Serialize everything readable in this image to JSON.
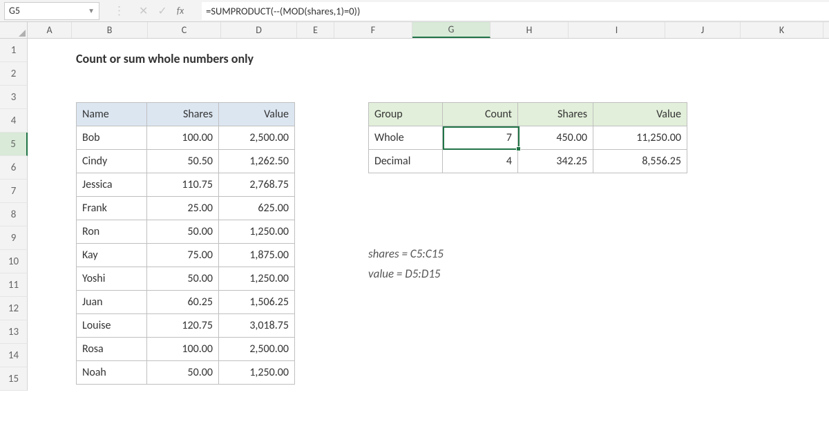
{
  "formula_bar": {
    "cell_ref": "G5",
    "fx_label": "fx",
    "formula": "=SUMPRODUCT(--(MOD(shares,1)=0))"
  },
  "columns": [
    "A",
    "B",
    "C",
    "D",
    "E",
    "F",
    "G",
    "H",
    "I",
    "J",
    "K"
  ],
  "active_column": "G",
  "rows": [
    "1",
    "2",
    "3",
    "4",
    "5",
    "6",
    "7",
    "8",
    "9",
    "10",
    "11",
    "12",
    "13",
    "14",
    "15"
  ],
  "active_row": "5",
  "title": "Count or sum whole numbers only",
  "table1": {
    "headers": {
      "name": "Name",
      "shares": "Shares",
      "value": "Value"
    },
    "rows": [
      {
        "name": "Bob",
        "shares": "100.00",
        "value": "2,500.00"
      },
      {
        "name": "Cindy",
        "shares": "50.50",
        "value": "1,262.50"
      },
      {
        "name": "Jessica",
        "shares": "110.75",
        "value": "2,768.75"
      },
      {
        "name": "Frank",
        "shares": "25.00",
        "value": "625.00"
      },
      {
        "name": "Ron",
        "shares": "50.00",
        "value": "1,250.00"
      },
      {
        "name": "Kay",
        "shares": "75.00",
        "value": "1,875.00"
      },
      {
        "name": "Yoshi",
        "shares": "50.00",
        "value": "1,250.00"
      },
      {
        "name": "Juan",
        "shares": "60.25",
        "value": "1,506.25"
      },
      {
        "name": "Louise",
        "shares": "120.75",
        "value": "3,018.75"
      },
      {
        "name": "Rosa",
        "shares": "100.00",
        "value": "2,500.00"
      },
      {
        "name": "Noah",
        "shares": "50.00",
        "value": "1,250.00"
      }
    ]
  },
  "table2": {
    "headers": {
      "group": "Group",
      "count": "Count",
      "shares": "Shares",
      "value": "Value"
    },
    "rows": [
      {
        "group": "Whole",
        "count": "7",
        "shares": "450.00",
        "value": "11,250.00"
      },
      {
        "group": "Decimal",
        "count": "4",
        "shares": "342.25",
        "value": "8,556.25"
      }
    ]
  },
  "notes": {
    "line1": "shares = C5:C15",
    "line2": "value = D5:D15"
  }
}
